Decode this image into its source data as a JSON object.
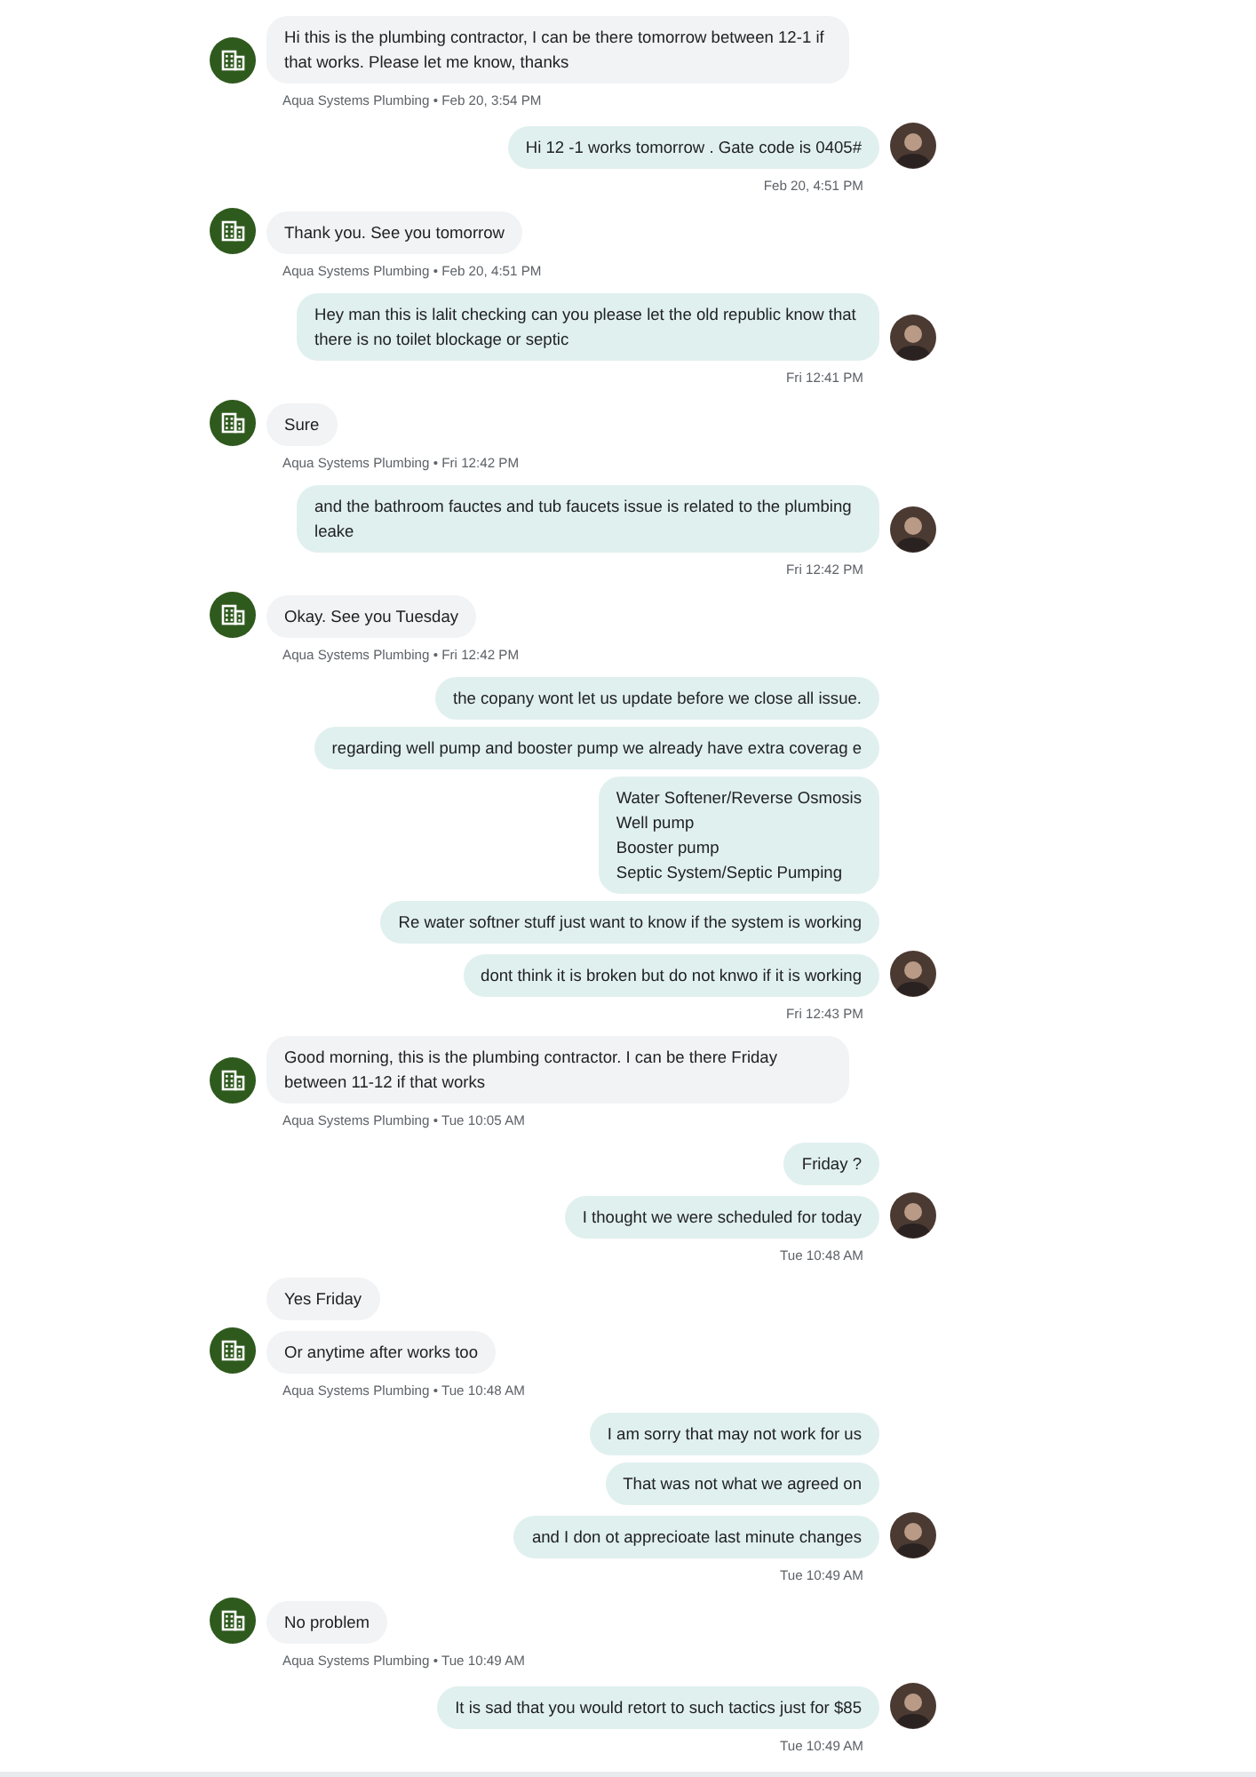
{
  "conversation": [
    {
      "kind": "incoming",
      "messages": [
        "Hi this is the plumbing contractor, I can be there tomorrow between 12-1 if that works. Please let me know, thanks"
      ],
      "meta": "Aqua Systems Plumbing • Feb 20, 3:54 PM"
    },
    {
      "kind": "outgoing",
      "messages": [
        "Hi 12 -1 works tomorrow . Gate code is 0405#"
      ],
      "meta": "Feb 20, 4:51 PM"
    },
    {
      "kind": "incoming",
      "messages": [
        "Thank you. See you tomorrow"
      ],
      "meta": "Aqua Systems Plumbing • Feb 20, 4:51 PM"
    },
    {
      "kind": "outgoing",
      "messages": [
        "Hey man this is lalit checking can you please let the old republic know that there is no toilet blockage or septic"
      ],
      "meta": "Fri 12:41 PM"
    },
    {
      "kind": "incoming",
      "messages": [
        "Sure"
      ],
      "meta": "Aqua Systems Plumbing • Fri 12:42 PM"
    },
    {
      "kind": "outgoing",
      "messages": [
        "and the bathroom fauctes and tub faucets issue is related to the plumbing leake"
      ],
      "meta": "Fri 12:42 PM"
    },
    {
      "kind": "incoming",
      "messages": [
        "Okay. See you Tuesday"
      ],
      "meta": "Aqua Systems Plumbing • Fri 12:42 PM"
    },
    {
      "kind": "outgoing",
      "messages": [
        "the copany wont let us update before we close all issue.",
        "regarding well pump and booster pump we already have extra coverag e",
        "Water Softener/Reverse Osmosis\nWell pump\nBooster pump\nSeptic System/Septic Pumping",
        "Re water softner stuff just want to know if the system is working",
        "dont think it is broken but do not knwo if it is working"
      ],
      "meta": "Fri 12:43 PM"
    },
    {
      "kind": "incoming",
      "messages": [
        "Good morning, this is the plumbing contractor. I can be there Friday between 11-12 if that works"
      ],
      "meta": "Aqua Systems Plumbing • Tue 10:05 AM"
    },
    {
      "kind": "outgoing",
      "messages": [
        "Friday ?",
        "I thought we were scheduled for today"
      ],
      "meta": "Tue 10:48 AM"
    },
    {
      "kind": "incoming",
      "messages": [
        "Yes Friday",
        "Or anytime after works too"
      ],
      "meta": "Aqua Systems Plumbing • Tue 10:48 AM"
    },
    {
      "kind": "outgoing",
      "messages": [
        "I am sorry that may not work for us",
        "That was not what we agreed on",
        "and I don ot apprecioate last minute changes"
      ],
      "meta": "Tue 10:49 AM"
    },
    {
      "kind": "incoming",
      "messages": [
        "No problem"
      ],
      "meta": "Aqua Systems Plumbing • Tue 10:49 AM"
    },
    {
      "kind": "outgoing",
      "messages": [
        "It is sad that you would retort to such tactics just for $85"
      ],
      "meta": "Tue 10:49 AM"
    }
  ]
}
